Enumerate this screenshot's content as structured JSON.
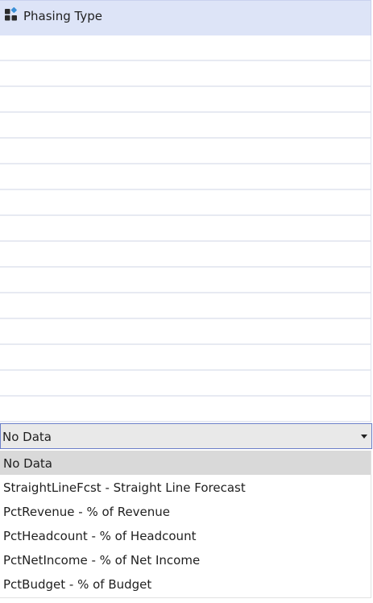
{
  "column_header": {
    "label": "Phasing Type",
    "icon": "field-type-icon",
    "background": "#dde4f7"
  },
  "grid": {
    "row_count": 15
  },
  "combo": {
    "value": "No Data",
    "arrow_icon": "chevron-down-icon"
  },
  "dropdown": {
    "options": [
      {
        "label": "No Data",
        "selected": true
      },
      {
        "label": "StraightLineFcst - Straight Line Forecast",
        "selected": false
      },
      {
        "label": "PctRevenue - % of Revenue",
        "selected": false
      },
      {
        "label": "PctHeadcount - % of Headcount",
        "selected": false
      },
      {
        "label": "PctNetIncome - % of Net Income",
        "selected": false
      },
      {
        "label": "PctBudget - % of Budget",
        "selected": false
      }
    ],
    "selected_background": "#d9d9d9"
  }
}
